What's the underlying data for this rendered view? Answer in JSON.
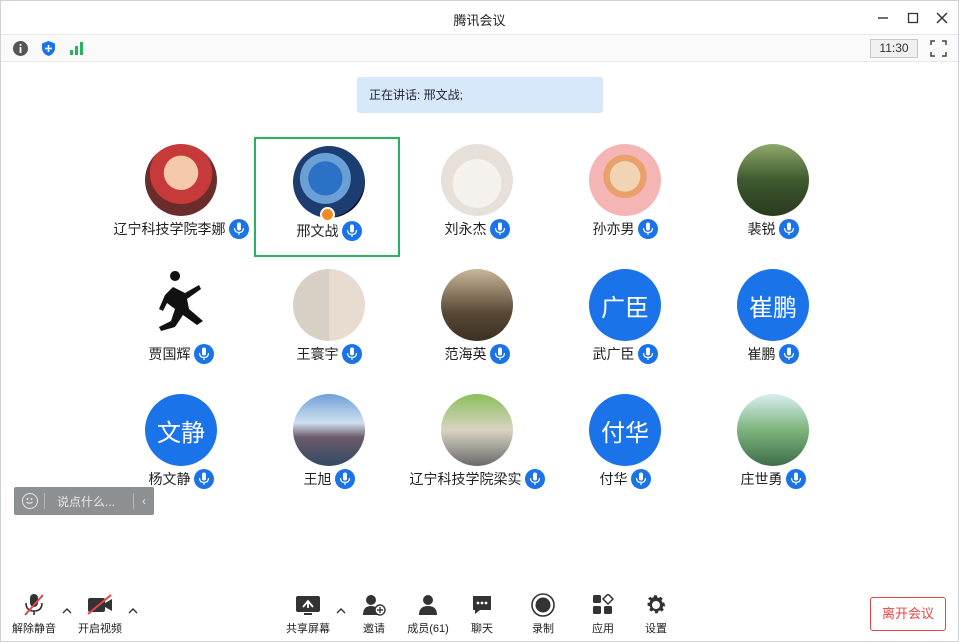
{
  "window": {
    "title": "腾讯会议"
  },
  "topbar": {
    "clock": "11:30"
  },
  "speaking": {
    "text": "正在讲话: 邢文战;"
  },
  "participants": [
    {
      "name": "辽宁科技学院李娜",
      "avatar": "photo",
      "mic": "mic-icon"
    },
    {
      "name": "邢文战",
      "avatar": "photo",
      "mic": "mic-icon",
      "active": true,
      "host": true
    },
    {
      "name": "刘永杰",
      "avatar": "photo",
      "mic": "mic-icon"
    },
    {
      "name": "孙亦男",
      "avatar": "photo",
      "mic": "mic-icon"
    },
    {
      "name": "裴锐",
      "avatar": "photo",
      "mic": "mic-icon"
    },
    {
      "name": "贾国辉",
      "avatar": "photo",
      "mic": "mic-icon"
    },
    {
      "name": "王寰宇",
      "avatar": "photo",
      "mic": "mic-icon"
    },
    {
      "name": "范海英",
      "avatar": "photo",
      "mic": "mic-icon"
    },
    {
      "name": "武广臣",
      "avatar_text": "广臣",
      "mic": "mic-icon"
    },
    {
      "name": "崔鹏",
      "avatar_text": "崔鹏",
      "mic": "mic-icon"
    },
    {
      "name": "杨文静",
      "avatar_text": "文静",
      "mic": "mic-icon"
    },
    {
      "name": "王旭",
      "avatar": "photo",
      "mic": "mic-icon"
    },
    {
      "name": "辽宁科技学院梁实",
      "avatar": "photo",
      "mic": "mic-icon"
    },
    {
      "name": "付华",
      "avatar_text": "付华",
      "mic": "mic-icon"
    },
    {
      "name": "庄世勇",
      "avatar": "photo",
      "mic": "mic-icon"
    }
  ],
  "chat": {
    "placeholder": "说点什么..."
  },
  "bottombar": {
    "unmute": "解除静音",
    "start_video": "开启视频",
    "share_screen": "共享屏幕",
    "invite": "邀请",
    "members": "成员(61)",
    "chat": "聊天",
    "record": "录制",
    "apps": "应用",
    "settings": "设置",
    "leave": "离开会议"
  },
  "colors": {
    "accent": "#1a73e8",
    "active_border": "#27b35e",
    "leave": "#e54545",
    "speaking_bg": "#d8e8fb"
  }
}
